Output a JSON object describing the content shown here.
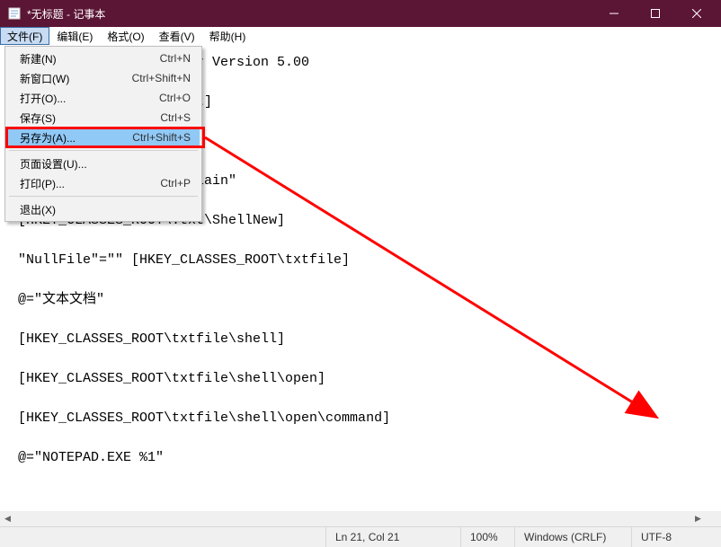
{
  "window": {
    "title": "*无标题 - 记事本"
  },
  "menubar": {
    "file": "文件(F)",
    "edit": "编辑(E)",
    "format": "格式(O)",
    "view": "查看(V)",
    "help": "帮助(H)"
  },
  "file_menu": {
    "new": {
      "label": "新建(N)",
      "shortcut": "Ctrl+N"
    },
    "new_window": {
      "label": "新窗口(W)",
      "shortcut": "Ctrl+Shift+N"
    },
    "open": {
      "label": "打开(O)...",
      "shortcut": "Ctrl+O"
    },
    "save": {
      "label": "保存(S)",
      "shortcut": "Ctrl+S"
    },
    "save_as": {
      "label": "另存为(A)...",
      "shortcut": "Ctrl+Shift+S"
    },
    "page_setup": {
      "label": "页面设置(U)...",
      "shortcut": ""
    },
    "print": {
      "label": "打印(P)...",
      "shortcut": "Ctrl+P"
    },
    "exit": {
      "label": "退出(X)",
      "shortcut": ""
    }
  },
  "editor": {
    "content": "Windows Registry Editor Version 5.00\n\n[HKEY_CLASSES_ROOT\\.txt]\n\n@=\"txtfile\"\n\n\"Content Type\"=\"text/plain\"\n\n[HKEY_CLASSES_ROOT\\.txt\\ShellNew]\n\n\"NullFile\"=\"\" [HKEY_CLASSES_ROOT\\txtfile]\n\n@=\"文本文档\"\n\n[HKEY_CLASSES_ROOT\\txtfile\\shell]\n\n[HKEY_CLASSES_ROOT\\txtfile\\shell\\open]\n\n[HKEY_CLASSES_ROOT\\txtfile\\shell\\open\\command]\n\n@=\"NOTEPAD.EXE %1\""
  },
  "statusbar": {
    "position": "Ln 21,  Col 21",
    "zoom": "100%",
    "line_ending": "Windows (CRLF)",
    "encoding": "UTF-8"
  }
}
